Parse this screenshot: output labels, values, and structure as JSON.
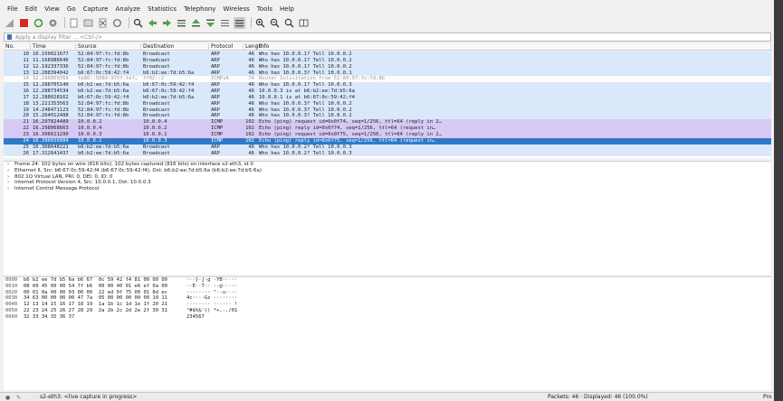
{
  "menu": [
    "File",
    "Edit",
    "View",
    "Go",
    "Capture",
    "Analyze",
    "Statistics",
    "Telephony",
    "Wireless",
    "Tools",
    "Help"
  ],
  "toolbar_icons": [
    "shark-fin-icon",
    "stop-icon",
    "restart-icon",
    "options-gear-icon",
    "open-file-icon",
    "save-file-icon",
    "close-file-icon",
    "reload-icon",
    "find-icon",
    "back-arrow-icon",
    "forward-arrow-icon",
    "go-to-packet-icon",
    "first-packet-icon",
    "last-packet-icon",
    "autoscroll-icon",
    "colorize-icon",
    "zoom-in-icon",
    "zoom-out-icon",
    "zoom-normal-icon",
    "resize-columns-icon"
  ],
  "filter": {
    "placeholder": "Apply a display filter ... <Ctrl-/>"
  },
  "columns": {
    "no": "No.",
    "time": "Time",
    "src": "Source",
    "dst": "Destination",
    "proto": "Protocol",
    "len": "Length",
    "info": "Info"
  },
  "colors": {
    "arp": "#dae8fb",
    "icmp": "#d6caf5",
    "icmpv6": "#fcfcfc",
    "selected": "#2f7ac8",
    "header": "#f7f7f7"
  },
  "packets": [
    {
      "no": "10",
      "time": "10.150021677",
      "src": "52:84:97:fc:fd:8b",
      "dst": "Broadcast",
      "proto": "ARP",
      "len": "46",
      "info": "Who has 10.0.0.1? Tell 10.0.0.2",
      "kind": "arp"
    },
    {
      "no": "11",
      "time": "11.168986646",
      "src": "52:84:97:fc:fd:8b",
      "dst": "Broadcast",
      "proto": "ARP",
      "len": "46",
      "info": "Who has 10.0.0.1? Tell 10.0.0.2",
      "kind": "arp"
    },
    {
      "no": "12",
      "time": "12.192337336",
      "src": "52:84:97:fc:fd:8b",
      "dst": "Broadcast",
      "proto": "ARP",
      "len": "46",
      "info": "Who has 10.0.0.1? Tell 10.0.0.2",
      "kind": "arp"
    },
    {
      "no": "13",
      "time": "12.288394042",
      "src": "b6:67:0c:59:42:f4",
      "dst": "b6:b2:ee:7d:b5:6a",
      "proto": "ARP",
      "len": "46",
      "info": "Who has 10.0.0.3? Tell 10.0.0.1",
      "kind": "arp"
    },
    {
      "no": "14",
      "time": "12.288869368",
      "src": "fe80::5084:97ff:fef…",
      "dst": "ff02::2",
      "proto": "ICMPv6",
      "len": "74",
      "info": "Router Solicitation from 52:84:97:fc:fd:8b",
      "kind": "icmpv6"
    },
    {
      "no": "15",
      "time": "12.288705140",
      "src": "b6:b2:ee:7d:b5:6a",
      "dst": "b6:67:0c:59:42:f4",
      "proto": "ARP",
      "len": "46",
      "info": "Who has 10.0.0.1? Tell 10.0.0.3",
      "kind": "arp"
    },
    {
      "no": "16",
      "time": "12.288734534",
      "src": "b6:b2:ee:7d:b5:6a",
      "dst": "b6:67:0c:59:42:f4",
      "proto": "ARP",
      "len": "46",
      "info": "10.0.0.3 is at b6:b2:ee:7d:b5:6a",
      "kind": "arp"
    },
    {
      "no": "17",
      "time": "12.288028162",
      "src": "b6:67:0c:59:42:f4",
      "dst": "b6:b2:ee:7d:b5:6a",
      "proto": "ARP",
      "len": "46",
      "info": "10.0.0.1 is at b6:67:0c:59:42:f4",
      "kind": "arp"
    },
    {
      "no": "18",
      "time": "13.221353563",
      "src": "52:84:97:fc:fd:8b",
      "dst": "Broadcast",
      "proto": "ARP",
      "len": "46",
      "info": "Who has 10.0.0.3? Tell 10.0.0.2",
      "kind": "arp"
    },
    {
      "no": "19",
      "time": "14.248471123",
      "src": "52:84:97:fc:fd:8b",
      "dst": "Broadcast",
      "proto": "ARP",
      "len": "46",
      "info": "Who has 10.0.0.3? Tell 10.0.0.2",
      "kind": "arp"
    },
    {
      "no": "20",
      "time": "15.264012488",
      "src": "52:84:97:fc:fd:8b",
      "dst": "Broadcast",
      "proto": "ARP",
      "len": "46",
      "info": "Who has 10.0.0.3? Tell 10.0.0.2",
      "kind": "arp"
    },
    {
      "no": "21",
      "time": "16.297824489",
      "src": "10.0.0.2",
      "dst": "10.0.0.4",
      "proto": "ICMP",
      "len": "102",
      "info": "Echo (ping) request  id=0x0f74, seq=1/256, ttl=64 (reply in 2…",
      "kind": "icmp"
    },
    {
      "no": "22",
      "time": "16.298068663",
      "src": "10.0.0.4",
      "dst": "10.0.0.2",
      "proto": "ICMP",
      "len": "102",
      "info": "Echo (ping) reply    id=0x0f74, seq=1/256, ttl=64 (request in…",
      "kind": "icmp"
    },
    {
      "no": "23",
      "time": "16.396611290",
      "src": "10.0.0.3",
      "dst": "10.0.0.1",
      "proto": "ICMP",
      "len": "102",
      "info": "Echo (ping) request  id=0x0f75, seq=1/256, ttl=64 (reply in 2…",
      "kind": "icmp"
    },
    {
      "no": "24",
      "time": "16.396656084",
      "src": "10.0.0.1",
      "dst": "10.0.0.3",
      "proto": "ICMP",
      "len": "102",
      "info": "Echo (ping) reply    id=0x0f75, seq=1/256, ttl=64 (request in…",
      "kind": "selected"
    },
    {
      "no": "25",
      "time": "16.308648221",
      "src": "b6:b2:ee:7d:b5:6a",
      "dst": "Broadcast",
      "proto": "ARP",
      "len": "46",
      "info": "Who has 10.0.0.2? Tell 10.0.0.3",
      "kind": "arp"
    },
    {
      "no": "26",
      "time": "17.312841437",
      "src": "b6:b2:ee:7d:b5:6a",
      "dst": "Broadcast",
      "proto": "ARP",
      "len": "46",
      "info": "Who has 10.0.0.2? Tell 10.0.0.3",
      "kind": "arp"
    }
  ],
  "details": [
    "Frame 24: 102 bytes on wire (816 bits), 102 bytes captured (816 bits) on interface s2-eth3, id 0",
    "Ethernet II, Src: b6:67:0c:59:42:f4 (b6:67:0c:59:42:f4), Dst: b6:b2:ee:7d:b5:6a (b6:b2:ee:7d:b5:6a)",
    "802.1Q Virtual LAN, PRI: 0, DEI: 0, ID: 0",
    "Internet Protocol Version 4, Src: 10.0.0.1, Dst: 10.0.0.3",
    "Internet Control Message Protocol"
  ],
  "bytes": [
    {
      "off": "0000",
      "hex": "b6 b2 ee 7d b5 6a b6 67  0c 59 42 f4 81 00 00 00",
      "ascii": "···}·j·g ·YB·····"
    },
    {
      "off": "0010",
      "hex": "08 00 45 00 00 54 7f b6  00 00 40 01 e6 ef 0a 00",
      "ascii": "··E··T·· ··@·····"
    },
    {
      "off": "0020",
      "hex": "00 01 0a 00 00 03 00 00  22 ed 0f 75 00 01 8d ec",
      "ascii": "········ \"··u····"
    },
    {
      "off": "0030",
      "hex": "34 63 00 00 00 00 47 7a  05 00 00 00 00 00 10 11",
      "ascii": "4c····Gz ········"
    },
    {
      "off": "0040",
      "hex": "12 13 14 15 16 17 18 19  1a 1b 1c 1d 1e 1f 20 21",
      "ascii": "········ ······ !"
    },
    {
      "off": "0050",
      "hex": "22 23 24 25 26 27 28 29  2a 2b 2c 2d 2e 2f 30 31",
      "ascii": "\"#$%&'() *+,-./01"
    },
    {
      "off": "0060",
      "hex": "32 33 34 35 36 37",
      "ascii": "234567"
    }
  ],
  "status": {
    "interface": "s2-eth3: <live capture in progress>",
    "packets": "Packets: 46 · Displayed: 46 (100.0%)",
    "profile": "Pro"
  }
}
